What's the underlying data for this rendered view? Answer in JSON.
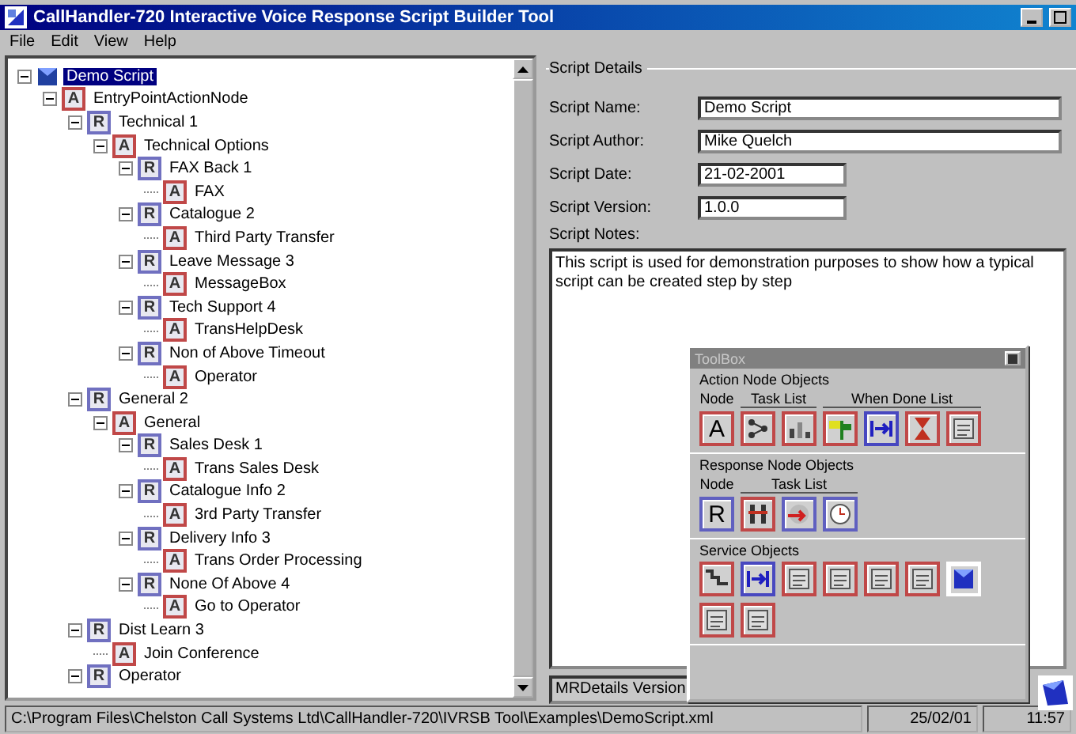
{
  "window": {
    "title": "CallHandler-720 Interactive Voice Response Script Builder Tool"
  },
  "menu": [
    "File",
    "Edit",
    "View",
    "Help"
  ],
  "tree": [
    {
      "label": "Demo Script",
      "kind": "script",
      "selected": true,
      "expanded": true,
      "children": [
        {
          "label": "EntryPointActionNode",
          "kind": "action",
          "badge": "A",
          "selected": false,
          "expanded": true,
          "children": [
            {
              "label": "Technical 1",
              "kind": "response",
              "badge": "R",
              "selected": false,
              "expanded": true,
              "children": [
                {
                  "label": "Technical Options",
                  "kind": "action",
                  "badge": "A",
                  "selected": false,
                  "expanded": true,
                  "children": [
                    {
                      "label": "FAX Back 1",
                      "kind": "response",
                      "badge": "R",
                      "selected": false,
                      "expanded": true,
                      "children": [
                        {
                          "label": "FAX",
                          "kind": "action",
                          "badge": "A",
                          "selected": false,
                          "expanded": false
                        }
                      ]
                    },
                    {
                      "label": "Catalogue 2",
                      "kind": "response",
                      "badge": "R",
                      "selected": false,
                      "expanded": true,
                      "children": [
                        {
                          "label": "Third Party Transfer",
                          "kind": "action",
                          "badge": "A",
                          "selected": false,
                          "expanded": false
                        }
                      ]
                    },
                    {
                      "label": "Leave Message 3",
                      "kind": "response",
                      "badge": "R",
                      "selected": false,
                      "expanded": true,
                      "children": [
                        {
                          "label": "MessageBox",
                          "kind": "action",
                          "badge": "A",
                          "selected": false,
                          "expanded": false
                        }
                      ]
                    },
                    {
                      "label": "Tech Support 4",
                      "kind": "response",
                      "badge": "R",
                      "selected": false,
                      "expanded": true,
                      "children": [
                        {
                          "label": "TransHelpDesk",
                          "kind": "action",
                          "badge": "A",
                          "selected": false,
                          "expanded": false
                        }
                      ]
                    },
                    {
                      "label": "Non of Above Timeout",
                      "kind": "response",
                      "badge": "R",
                      "selected": false,
                      "expanded": true,
                      "children": [
                        {
                          "label": "Operator",
                          "kind": "action",
                          "badge": "A",
                          "selected": false,
                          "expanded": false
                        }
                      ]
                    }
                  ]
                }
              ]
            },
            {
              "label": "General 2",
              "kind": "response",
              "badge": "R",
              "selected": false,
              "expanded": true,
              "children": [
                {
                  "label": "General",
                  "kind": "action",
                  "badge": "A",
                  "selected": false,
                  "expanded": true,
                  "children": [
                    {
                      "label": "Sales Desk 1",
                      "kind": "response",
                      "badge": "R",
                      "selected": false,
                      "expanded": true,
                      "children": [
                        {
                          "label": "Trans Sales Desk",
                          "kind": "action",
                          "badge": "A",
                          "selected": false,
                          "expanded": false
                        }
                      ]
                    },
                    {
                      "label": "Catalogue Info 2",
                      "kind": "response",
                      "badge": "R",
                      "selected": false,
                      "expanded": true,
                      "children": [
                        {
                          "label": "3rd Party Transfer",
                          "kind": "action",
                          "badge": "A",
                          "selected": false,
                          "expanded": false
                        }
                      ]
                    },
                    {
                      "label": "Delivery Info 3",
                      "kind": "response",
                      "badge": "R",
                      "selected": false,
                      "expanded": true,
                      "children": [
                        {
                          "label": "Trans Order Processing",
                          "kind": "action",
                          "badge": "A",
                          "selected": false,
                          "expanded": false
                        }
                      ]
                    },
                    {
                      "label": "None Of Above 4",
                      "kind": "response",
                      "badge": "R",
                      "selected": false,
                      "expanded": true,
                      "children": [
                        {
                          "label": "Go to Operator",
                          "kind": "action",
                          "badge": "A",
                          "selected": false,
                          "expanded": false
                        }
                      ]
                    }
                  ]
                }
              ]
            },
            {
              "label": "Dist Learn 3",
              "kind": "response",
              "badge": "R",
              "selected": false,
              "expanded": true,
              "children": [
                {
                  "label": "Join Conference",
                  "kind": "action",
                  "badge": "A",
                  "selected": false,
                  "expanded": false
                }
              ]
            },
            {
              "label": "Operator",
              "kind": "response",
              "badge": "R",
              "selected": false,
              "expanded": true
            }
          ]
        }
      ]
    }
  ],
  "details": {
    "title": "Script Details",
    "fields": [
      {
        "label": "Script Name:",
        "value": "Demo Script",
        "wide": true
      },
      {
        "label": "Script Author:",
        "value": "Mike Quelch",
        "wide": true
      },
      {
        "label": "Script Date:",
        "value": "21-02-2001",
        "wide": false
      },
      {
        "label": "Script Version:",
        "value": "1.0.0",
        "wide": false
      }
    ],
    "notes_label": "Script Notes:",
    "notes": "This script is used for demonstration purposes to show how a typical script can be created step by step",
    "version_field": "MRDetails Version"
  },
  "toolbox": {
    "title": "ToolBox",
    "groups": [
      {
        "title": "Action Node Objects",
        "headings": [
          "Node",
          "Task List",
          "When Done List"
        ],
        "buttons": [
          {
            "kind": "letter",
            "label": "A",
            "color": "#c04848"
          },
          {
            "kind": "network",
            "color": "#c04848"
          },
          {
            "kind": "chart",
            "color": "#c04848"
          },
          {
            "kind": "flag",
            "color": "#c04848"
          },
          {
            "kind": "link",
            "color": "#4848c0"
          },
          {
            "kind": "hourglass",
            "color": "#c04848"
          },
          {
            "kind": "document",
            "color": "#c04848"
          }
        ]
      },
      {
        "title": "Response Node Objects",
        "headings": [
          "Node",
          "Task List"
        ],
        "buttons": [
          {
            "kind": "letter",
            "label": "R",
            "color": "#6060c0"
          },
          {
            "kind": "bars",
            "color": "#c04848"
          },
          {
            "kind": "arrow",
            "color": "#6060c0"
          },
          {
            "kind": "clock",
            "color": "#6060c0"
          }
        ]
      },
      {
        "title": "Service Objects",
        "buttons": [
          {
            "kind": "stairs",
            "color": "#c04848"
          },
          {
            "kind": "link",
            "color": "#4848c0"
          },
          {
            "kind": "document",
            "color": "#c04848"
          },
          {
            "kind": "document",
            "color": "#c04848"
          },
          {
            "kind": "document",
            "color": "#c04848"
          },
          {
            "kind": "document",
            "color": "#c04848"
          },
          {
            "kind": "cube",
            "color": "#ffffff"
          },
          {
            "kind": "document",
            "color": "#c04848"
          },
          {
            "kind": "document",
            "color": "#c04848"
          }
        ]
      }
    ]
  },
  "status_bar": [
    "C:\\Program Files\\Chelston Call Systems Ltd\\CallHandler-720\\IVRSB Tool\\Examples\\DemoScript.xml",
    "25/02/01",
    "11:57"
  ]
}
